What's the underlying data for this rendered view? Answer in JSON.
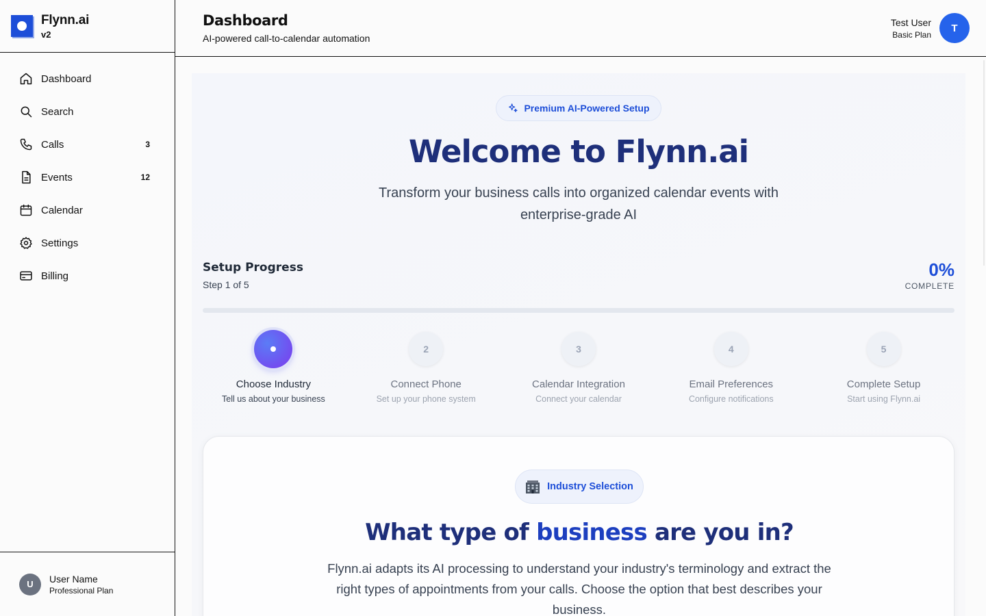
{
  "brand": {
    "name": "Flynn.ai",
    "version": "v2"
  },
  "sidebar": {
    "items": [
      {
        "label": "Dashboard",
        "count": ""
      },
      {
        "label": "Search",
        "count": ""
      },
      {
        "label": "Calls",
        "count": "3"
      },
      {
        "label": "Events",
        "count": "12"
      },
      {
        "label": "Calendar",
        "count": ""
      },
      {
        "label": "Settings",
        "count": ""
      },
      {
        "label": "Billing",
        "count": ""
      }
    ],
    "user": {
      "initial": "U",
      "name": "User Name",
      "plan": "Professional Plan"
    }
  },
  "header": {
    "title": "Dashboard",
    "subtitle": "AI-powered call-to-calendar automation",
    "user": {
      "name": "Test User",
      "plan": "Basic Plan",
      "initial": "T"
    }
  },
  "hero": {
    "badge": "Premium AI-Powered Setup",
    "title": "Welcome to Flynn.ai",
    "tagline": "Transform your business calls into organized calendar events with enterprise-grade AI"
  },
  "progress": {
    "title": "Setup Progress",
    "step_text": "Step 1 of 5",
    "percent_label": "0%",
    "complete_label": "COMPLETE",
    "fraction": 0,
    "steps": [
      {
        "num": "",
        "name": "Choose Industry",
        "desc": "Tell us about your business",
        "active": true
      },
      {
        "num": "2",
        "name": "Connect Phone",
        "desc": "Set up your phone system",
        "active": false
      },
      {
        "num": "3",
        "name": "Calendar Integration",
        "desc": "Connect your calendar",
        "active": false
      },
      {
        "num": "4",
        "name": "Email Preferences",
        "desc": "Configure notifications",
        "active": false
      },
      {
        "num": "5",
        "name": "Complete Setup",
        "desc": "Start using Flynn.ai",
        "active": false
      }
    ]
  },
  "industry_card": {
    "badge": "Industry Selection",
    "badge_icon": "office-building-icon",
    "title_pre": "What type of",
    "title_highlight": "business",
    "title_post": "are you in?",
    "body": "Flynn.ai adapts its AI processing to understand your industry's terminology and extract the right types of appointments from your calls. Choose the option that best describes your business."
  },
  "colors": {
    "accent": "#1d4ed8",
    "heading": "#1e2f7a",
    "avatar": "#2563eb"
  }
}
